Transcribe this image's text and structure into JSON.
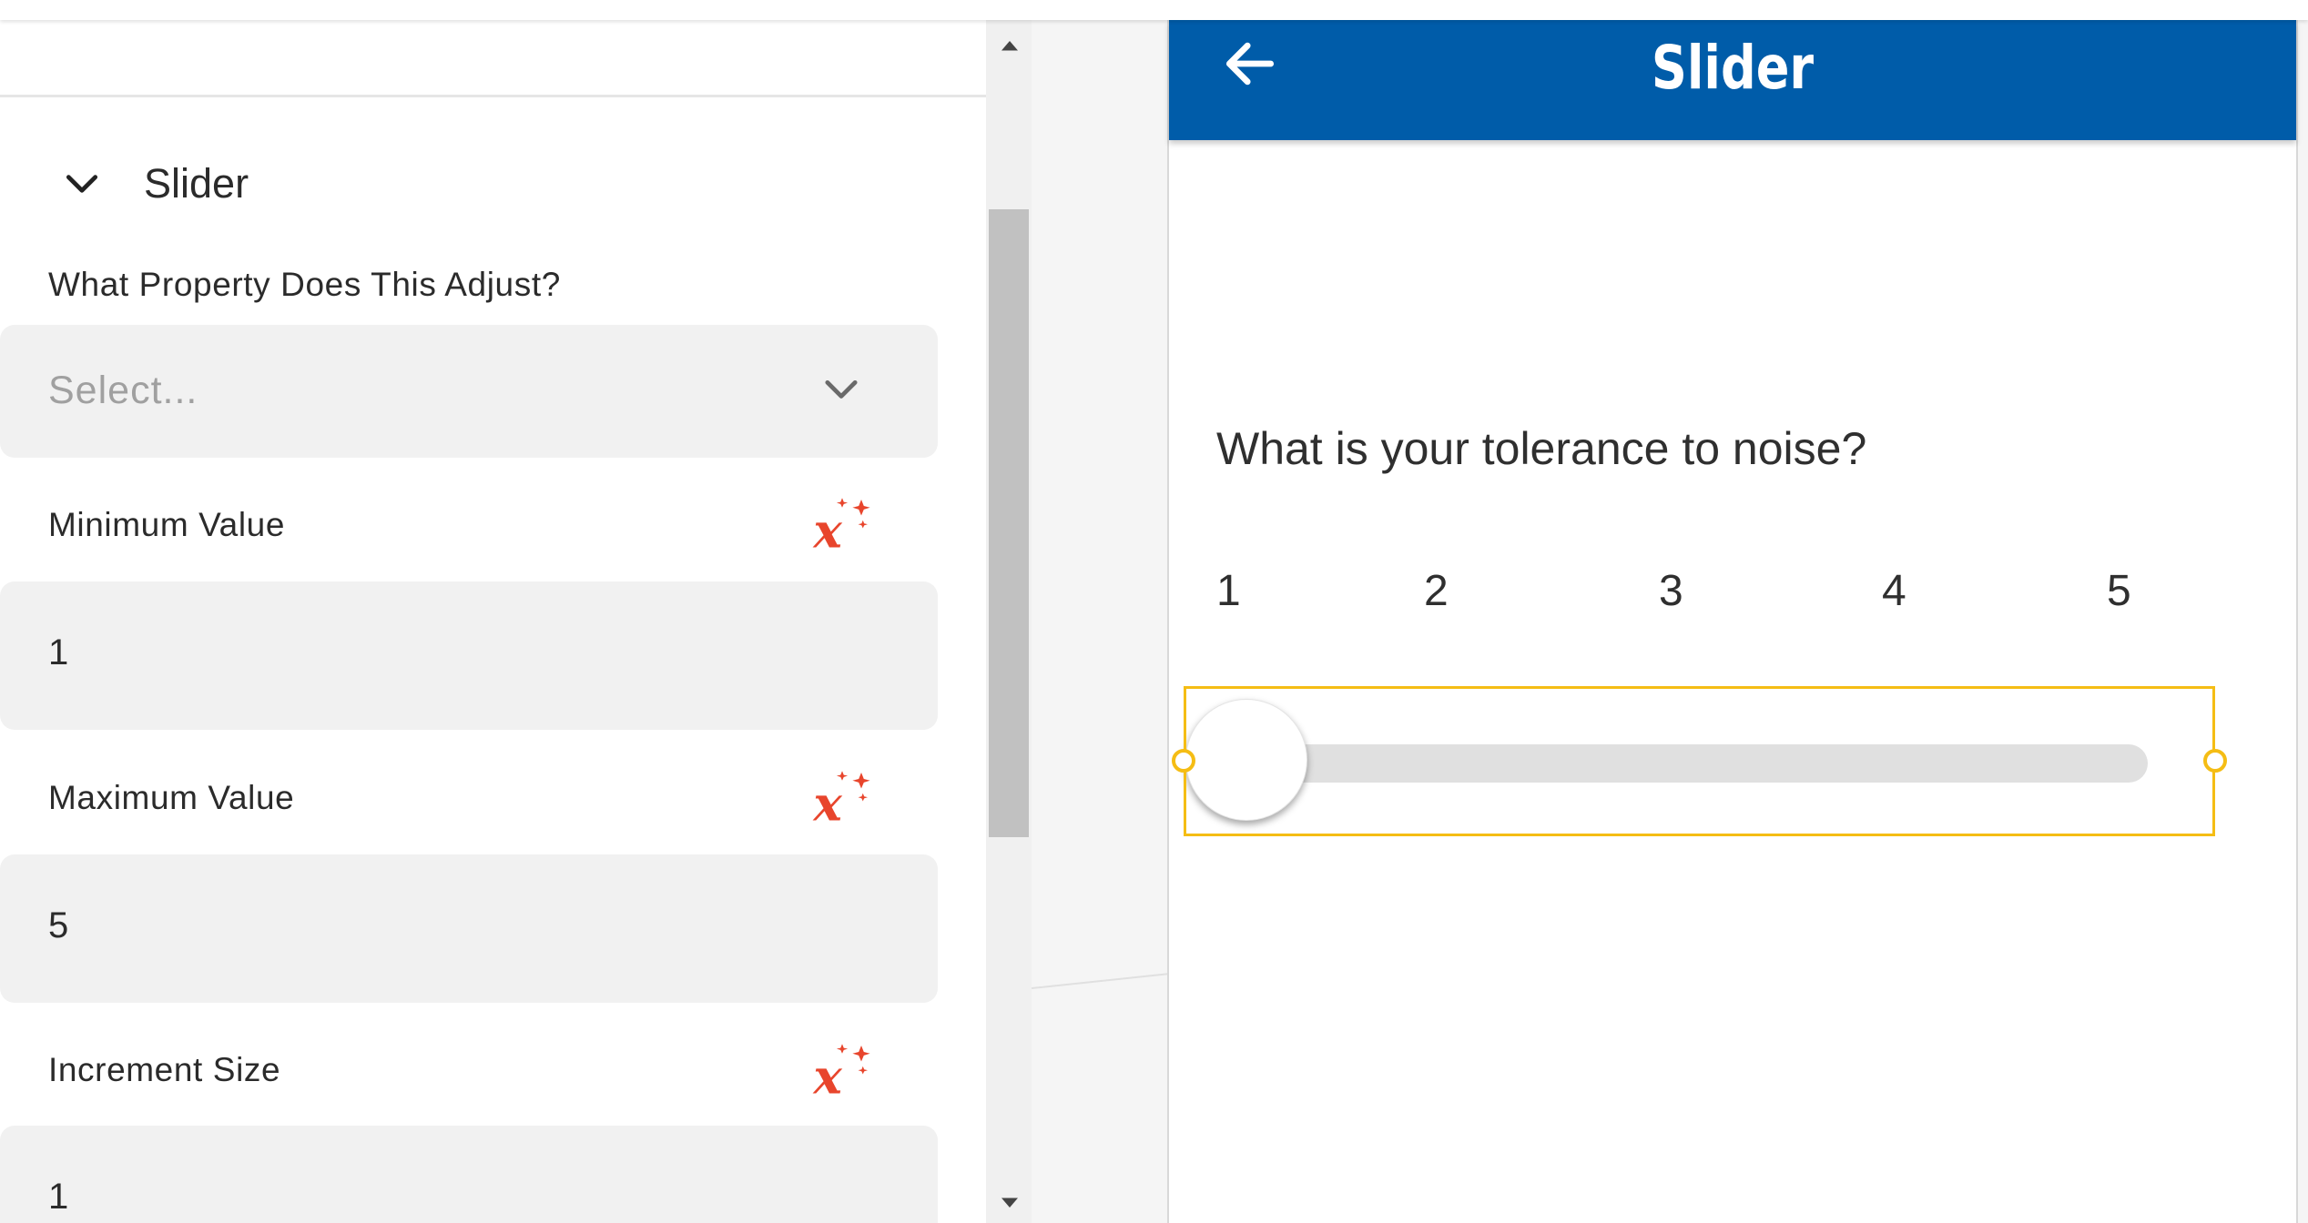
{
  "properties_panel": {
    "section": {
      "title": "Slider",
      "expanded": true,
      "icon": "chevron-down-icon"
    },
    "fields": {
      "property": {
        "label": "What Property Does This Adjust?",
        "placeholder": "Select...",
        "icon": "chevron-down-icon"
      },
      "minimum": {
        "label": "Minimum Value",
        "value": "1",
        "icon": "formula-icon"
      },
      "maximum": {
        "label": "Maximum Value",
        "value": "5",
        "icon": "formula-icon"
      },
      "increment": {
        "label": "Increment Size",
        "value": "1",
        "icon": "formula-icon"
      }
    }
  },
  "preview": {
    "header": {
      "title": "Slider",
      "back_icon": "back-arrow-icon",
      "color": "#005ca9"
    },
    "question": "What is your tolerance to noise?",
    "ticks": [
      "1",
      "2",
      "3",
      "4",
      "5"
    ],
    "slider": {
      "value": 1,
      "min": 1,
      "max": 5
    },
    "selection_color": "#f5bd14"
  },
  "colors": {
    "formula_icon": "#e8452c",
    "field_background": "#f1f1f1"
  }
}
